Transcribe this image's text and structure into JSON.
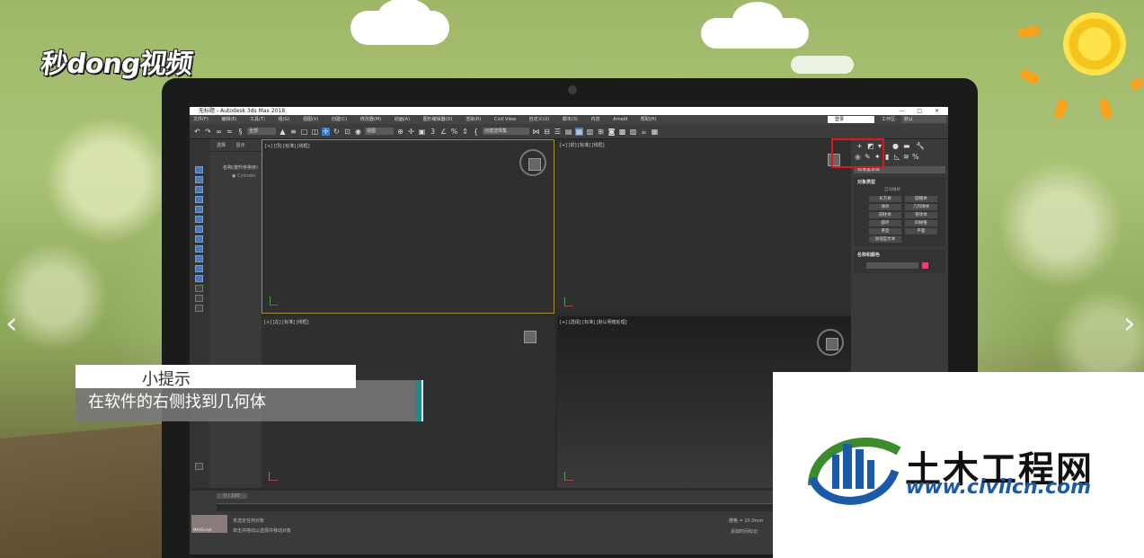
{
  "brand": {
    "logo_text": "秒dong视频"
  },
  "nav": {
    "prev": "‹",
    "next": "›"
  },
  "window": {
    "title": "无标题 - Autodesk 3ds Max 2018",
    "controls": "— □ ✕"
  },
  "menu": [
    "文件(F)",
    "编辑(E)",
    "工具(T)",
    "组(G)",
    "视图(V)",
    "创建(C)",
    "修改器(M)",
    "动画(A)",
    "图形编辑器(D)",
    "渲染(R)",
    "Civil View",
    "自定义(U)",
    "脚本(S)",
    "内容",
    "Arnold",
    "帮助(H)"
  ],
  "account": {
    "login": "登录",
    "workspace_label": "工作区:",
    "workspace_value": "默认"
  },
  "toolbar": {
    "filter": "全部",
    "view": "视图",
    "selection_set": "创建选择集"
  },
  "explorer": {
    "tabs": [
      "选择",
      "显示"
    ],
    "header": "名称(按升序排序)",
    "item": "Cylinder"
  },
  "viewports": [
    {
      "label": "[+] [顶] [标准] [线框]"
    },
    {
      "label": "[+] [前] [标准] [线框]"
    },
    {
      "label": "[+] [左] [标准] [线框]"
    },
    {
      "label": "[+] [透视] [标准] [默认明暗处理]"
    }
  ],
  "command_panel": {
    "category": "标准基本体",
    "object_type_header": "对象类型",
    "autogrid": "自动栅格",
    "objects": [
      "长方体",
      "圆锥体",
      "球体",
      "几何球体",
      "圆柱体",
      "管状体",
      "圆环",
      "四棱锥",
      "茶壶",
      "平面",
      "加强型文本"
    ],
    "name_color_header": "名称和颜色"
  },
  "timeline": {
    "frame": "0 / 100"
  },
  "status": {
    "line1": "未选定任何对象",
    "line2": "单击并拖动以选择并移动对象",
    "maxscript": "MAXScript",
    "grid": "栅格 = 10.0mm",
    "add_time_tag": "添加时间标记"
  },
  "tip": {
    "title": "小提示",
    "body": "在软件的右侧找到几何体"
  },
  "watermark": {
    "title": "土木工程网",
    "url": "www.civilcn.com"
  }
}
